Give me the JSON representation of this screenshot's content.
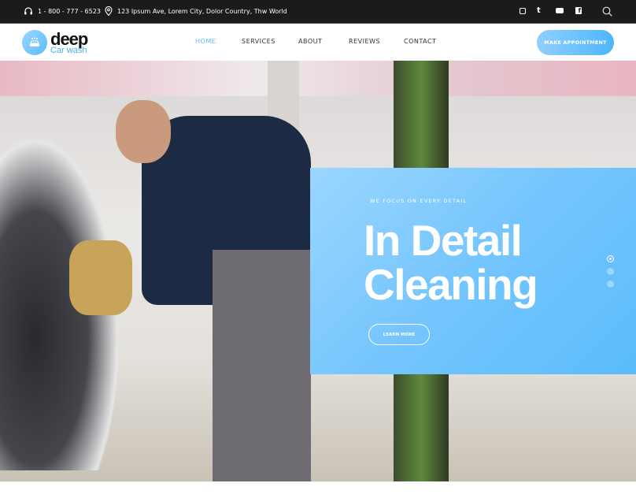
{
  "topbar": {
    "phone": "1 - 800 - 777 - 6523",
    "address": "123 Ipsum Ave, Lorem City, Dolor Country, Thw World",
    "social": [
      "instagram-icon",
      "twitter-icon",
      "youtube-icon",
      "facebook-icon"
    ]
  },
  "logo": {
    "name": "deep",
    "tagline": "Car wash"
  },
  "nav": [
    {
      "label": "HOME",
      "active": true
    },
    {
      "label": "SERVICES"
    },
    {
      "label": "ABOUT"
    },
    {
      "label": "REVIEWS"
    },
    {
      "label": "CONTACT"
    }
  ],
  "cta": "MAKE APPOINTMENT",
  "hero": {
    "kicker": "WE FOCUS ON EVERY DETAIL",
    "title_line1": "In Detail",
    "title_line2": "Cleaning",
    "button": "LEARN MORE",
    "slides": 3,
    "active_slide": 1
  },
  "colors": {
    "accent": "#5bbcfb",
    "topbar": "#1b1b1b"
  }
}
